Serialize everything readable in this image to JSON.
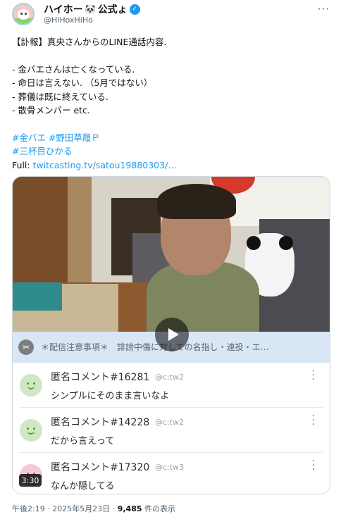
{
  "author": {
    "display_name": "ハイホー",
    "name_emoji": "🐼",
    "name_suffix": "公式ょ",
    "verified_mark": "✓",
    "handle": "@HiHoxHiHo",
    "more_icon": "···"
  },
  "tweet": {
    "lines": [
      "【訃報】真央さんからのLINE通話内容.",
      "- 金バエさんは亡くなっている.",
      "- 命日は言えない. （5月ではない）",
      "- 葬儀は既に終えている.",
      "- 散骨メンバー etc."
    ],
    "hashtags_line1": "#金バエ #野田草履Ｐ",
    "hashtags_line2": "#三杯目ひかる",
    "link_prefix": "Full: ",
    "link_text": "twitcasting.tv/satou19880303/…"
  },
  "media": {
    "notice_icon": "✂",
    "notice_text": "＊配信注意事項＊　誹謗中傷に対しての名指し・連投・エ…",
    "comments": [
      {
        "name": "匿名コメント#16281",
        "tag": "@c:tw2",
        "text": "シンプルにそのまま言いなよ",
        "avatar_color": "green"
      },
      {
        "name": "匿名コメント#14228",
        "tag": "@c:tw2",
        "text": "だから言えって",
        "avatar_color": "green"
      },
      {
        "name": "匿名コメント#17320",
        "tag": "@c:tw3",
        "text": "なんか隠してる",
        "avatar_color": "pink"
      }
    ],
    "duration": "3:30"
  },
  "meta": {
    "time": "午後2:19",
    "separator": " · ",
    "date": "2025年5月23日",
    "views": "9,485",
    "views_suffix": " 件の表示"
  },
  "colors": {
    "link": "#1d9bf0",
    "notice_bg": "#d9e6f6",
    "verified": "#1d9bf0"
  }
}
